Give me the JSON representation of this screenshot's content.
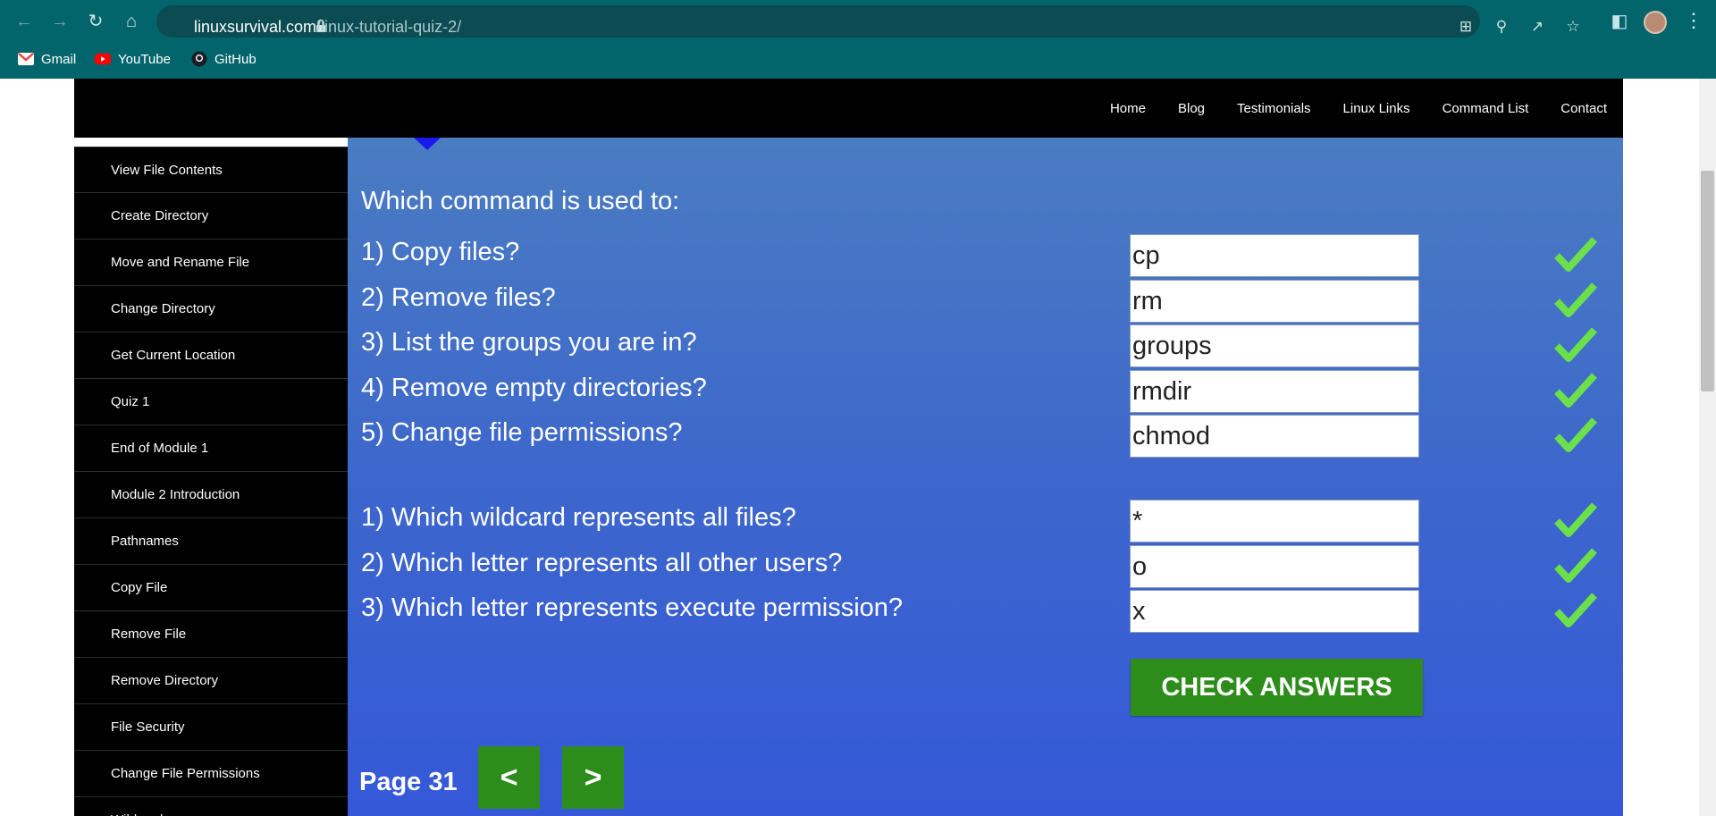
{
  "browser": {
    "url_domain": "linuxsurvival.com",
    "url_path": "/linux-tutorial-quiz-2/",
    "bookmarks": [
      {
        "label": "Gmail"
      },
      {
        "label": "YouTube"
      },
      {
        "label": "GitHub"
      }
    ]
  },
  "topnav": [
    "Home",
    "Blog",
    "Testimonials",
    "Linux Links",
    "Command List",
    "Contact"
  ],
  "sidebar": [
    "View File Contents",
    "Create Directory",
    "Move and Rename File",
    "Change Directory",
    "Get Current Location",
    "Quiz 1",
    "End of Module 1",
    "Module 2 Introduction",
    "Pathnames",
    "Copy File",
    "Remove File",
    "Remove Directory",
    "File Security",
    "Change File Permissions",
    "Wildcards"
  ],
  "quiz": {
    "heading": "Which command is used to:",
    "section1": [
      {
        "question": "1) Copy files?",
        "answer": "cp",
        "correct": true
      },
      {
        "question": "2) Remove files?",
        "answer": "rm",
        "correct": true
      },
      {
        "question": "3) List the groups you are in?",
        "answer": "groups",
        "correct": true
      },
      {
        "question": "4) Remove empty directories?",
        "answer": "rmdir",
        "correct": true
      },
      {
        "question": "5) Change file permissions?",
        "answer": "chmod",
        "correct": true
      }
    ],
    "section2": [
      {
        "question": "1) Which wildcard represents all files?",
        "answer": "*",
        "correct": true
      },
      {
        "question": "2) Which letter represents all other users?",
        "answer": "o",
        "correct": true
      },
      {
        "question": "3) Which letter represents execute permission?",
        "answer": "x",
        "correct": true
      }
    ],
    "check_label": "CHECK ANSWERS",
    "page_label": "Page 31",
    "prev_label": "<",
    "next_label": ">"
  },
  "colors": {
    "chrome": "#03656c",
    "content_top": "#4a7cc2",
    "content_bottom": "#3558d8",
    "button_green": "#2c8d1b",
    "check_green": "#6be04a"
  },
  "icons": [
    "back-icon",
    "forward-icon",
    "reload-icon",
    "home-icon",
    "lock-icon",
    "translate-icon",
    "zoom-icon",
    "share-icon",
    "star-icon",
    "sidepanel-icon",
    "profile-avatar",
    "menu-icon",
    "checkmark-icon"
  ]
}
